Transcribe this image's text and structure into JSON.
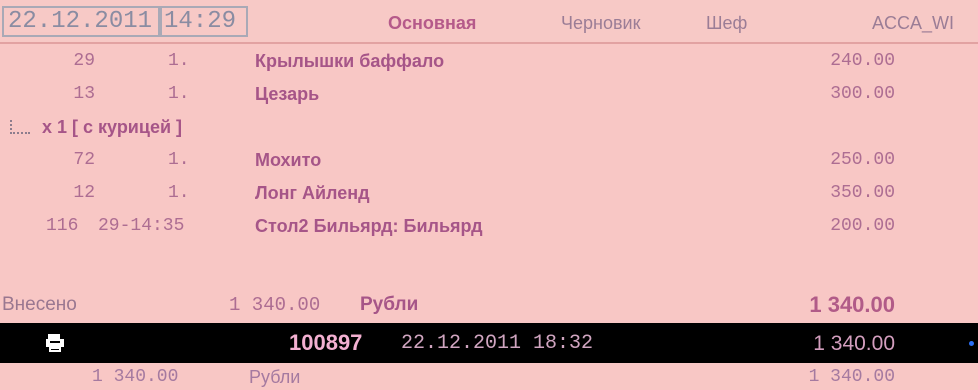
{
  "header": {
    "date": "22.12.2011",
    "time": "14:29",
    "mode": "Основная",
    "draft": "Черновик",
    "chef": "Шеф",
    "user": "ACCA_WI"
  },
  "items": [
    {
      "id": "29",
      "qty": "1.",
      "name": "Крылышки баффало",
      "sum": "240.00"
    },
    {
      "id": "13",
      "qty": "1.",
      "name": "Цезарь",
      "sum": "300.00"
    },
    {
      "modifier": "x 1  [ с курицей ]"
    },
    {
      "id": "72",
      "qty": "1.",
      "name": "Мохито",
      "sum": "250.00"
    },
    {
      "id": "12",
      "qty": "1.",
      "name": "Лонг Айленд",
      "sum": "350.00"
    },
    {
      "id": "116",
      "qty": "29-14:35",
      "name": "Стол2 Бильярд: Бильярд",
      "sum": "200.00"
    }
  ],
  "paid": {
    "label": "Внесено",
    "amount": "1 340.00",
    "currency": "Рубли",
    "total": "1 340.00"
  },
  "check": {
    "icon": "printer-icon",
    "number": "100897",
    "datetime": "22.12.2011 18:32",
    "total": "1 340.00"
  },
  "footer": {
    "sum": "1 340.00",
    "currency": "Рубли",
    "total": "1 340.00"
  },
  "colors": {
    "background": "#f8c7c5",
    "accent": "#a65588",
    "check_bar": "#000000"
  }
}
